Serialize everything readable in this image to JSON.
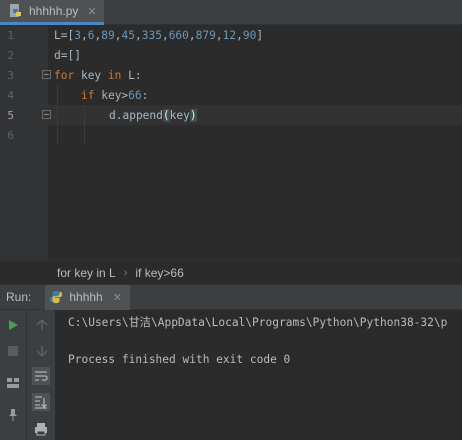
{
  "editor_tab": {
    "filename": "hhhhh.py",
    "close_glyph": "✕"
  },
  "gutter": {
    "line_numbers": [
      "1",
      "2",
      "3",
      "4",
      "5",
      "6"
    ]
  },
  "code": {
    "line1": {
      "var": "L",
      "op": "=",
      "open": "[",
      "n1": "3",
      "n2": "6",
      "n3": "89",
      "n4": "45",
      "n5": "335",
      "n6": "660",
      "n7": "879",
      "n8": "12",
      "n9": "90",
      "close": "]",
      "comma": ","
    },
    "line2": {
      "var": "d",
      "op": "=",
      "brackets": "[]"
    },
    "line3": {
      "for_kw": "for",
      "target": " key ",
      "in_kw": "in",
      "rest": " L:"
    },
    "line4": {
      "if_kw": "if",
      "cond": " key>",
      "num": "66",
      "colon": ":"
    },
    "line5": {
      "call": "d.append",
      "open_paren": "(",
      "arg": "key",
      "close_paren": ")"
    }
  },
  "breadcrumb": {
    "item1": "for key in L",
    "separator": "›",
    "item2": "if key>66"
  },
  "run_panel": {
    "label": "Run:",
    "config_name": "hhhhh",
    "close_glyph": "✕"
  },
  "console": {
    "command": "C:\\Users\\甘洁\\AppData\\Local\\Programs\\Python\\Python38-32\\p",
    "exit_message": "Process finished with exit code 0"
  },
  "colors": {
    "editor_bg": "#2b2b2b",
    "keyword": "#cc7832",
    "number": "#6897bb",
    "default_text": "#a9b7c6",
    "tab_underline": "#4a88c7",
    "run_green": "#499c54"
  },
  "icons": [
    "python-file-icon",
    "run-icon",
    "stop-icon",
    "up-arrow-icon",
    "down-arrow-icon",
    "soft-wrap-icon",
    "scroll-to-end-icon",
    "layout-icon",
    "print-icon",
    "pin-icon"
  ]
}
